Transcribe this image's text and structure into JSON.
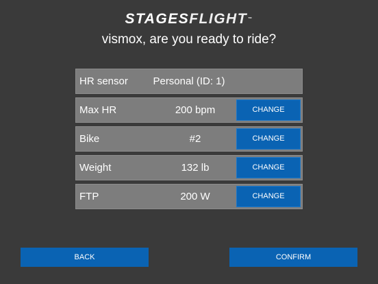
{
  "brand": {
    "part1": "STAGES",
    "part2": "FLIGHT",
    "mark": "™"
  },
  "greeting": "vismox, are you ready to ride?",
  "rows": [
    {
      "label": "HR sensor",
      "value": "Personal (ID: 1)"
    },
    {
      "label": "Max HR",
      "value": "200 bpm",
      "action": "CHANGE"
    },
    {
      "label": "Bike",
      "value": "#2",
      "action": "CHANGE"
    },
    {
      "label": "Weight",
      "value": "132 lb",
      "action": "CHANGE"
    },
    {
      "label": "FTP",
      "value": "200 W",
      "action": "CHANGE"
    }
  ],
  "footer": {
    "back_label": "BACK",
    "confirm_label": "CONFIRM"
  }
}
